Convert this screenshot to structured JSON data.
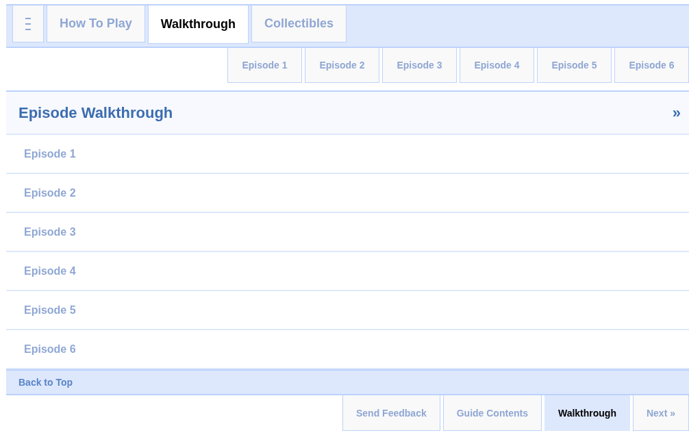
{
  "main_tabs": [
    {
      "label": "How To Play",
      "selected": false
    },
    {
      "label": "Walkthrough",
      "selected": true
    },
    {
      "label": "Collectibles",
      "selected": false
    }
  ],
  "sub_tabs": [
    {
      "label": "Episode 1"
    },
    {
      "label": "Episode 2"
    },
    {
      "label": "Episode 3"
    },
    {
      "label": "Episode 4"
    },
    {
      "label": "Episode 5"
    },
    {
      "label": "Episode 6"
    }
  ],
  "section": {
    "title": "Episode Walkthrough",
    "expand": "»"
  },
  "items": [
    {
      "label": "Episode 1"
    },
    {
      "label": "Episode 2"
    },
    {
      "label": "Episode 3"
    },
    {
      "label": "Episode 4"
    },
    {
      "label": "Episode 5"
    },
    {
      "label": "Episode 6"
    }
  ],
  "back_to_top": "Back to Top",
  "footer_tabs": [
    {
      "label": "Send Feedback",
      "selected": false
    },
    {
      "label": "Guide Contents",
      "selected": false
    },
    {
      "label": "Walkthrough",
      "selected": true
    },
    {
      "label": "Next »",
      "selected": false
    }
  ]
}
